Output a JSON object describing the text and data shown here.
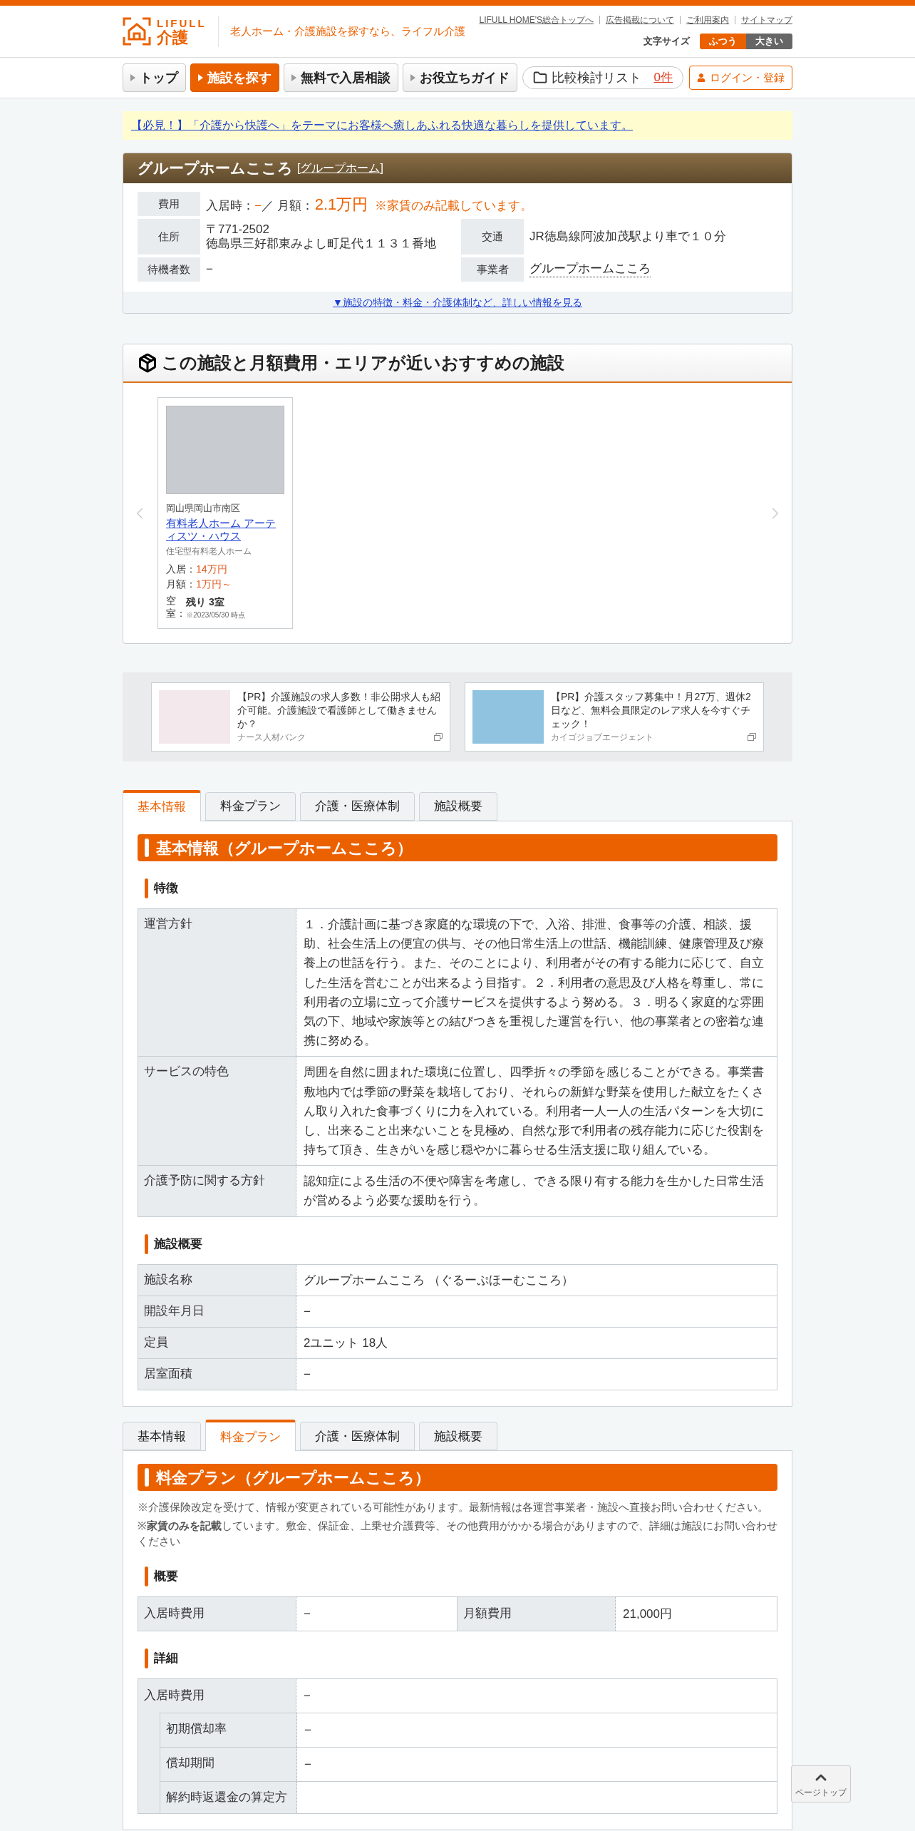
{
  "header": {
    "logo_text": "LIFULL",
    "logo_sub": "介護",
    "tagline": "老人ホーム・介護施設を探すなら、ライフル介護",
    "links": [
      "LIFULL HOME'S総合トップへ",
      "広告掲載について",
      "ご利用案内",
      "サイトマップ"
    ],
    "font_size": {
      "label": "文字サイズ",
      "options": [
        {
          "label": "ふつう",
          "selected": true
        },
        {
          "label": "大きい",
          "selected": false
        }
      ]
    }
  },
  "nav": {
    "items": [
      {
        "label": "トップ",
        "selected": false
      },
      {
        "label": "施設を探す",
        "selected": true
      },
      {
        "label": "無料で入居相談",
        "selected": false
      },
      {
        "label": "お役立ちガイド",
        "selected": false
      }
    ],
    "compare": {
      "label": "比較検討リスト",
      "count": "0件"
    },
    "login": "ログイン・登録"
  },
  "notice": "【必見！】「介護から快護へ」をテーマにお客様へ癒しあふれる快適な暮らしを提供しています。",
  "facility": {
    "name": "グループホームこころ",
    "type": "[グループホーム]",
    "cost": {
      "label": "費用",
      "parts": [
        {
          "kind": "plain",
          "text": "入居時："
        },
        {
          "kind": "accent",
          "text": "−"
        },
        {
          "kind": "plain",
          "text": "／ 月額："
        },
        {
          "kind": "price",
          "text": "2.1万円"
        },
        {
          "kind": "note",
          "text": "※家賃のみ記載しています。"
        }
      ]
    },
    "address": {
      "label": "住所",
      "lines": [
        "〒771-2502",
        "徳島県三好郡東みよし町足代１１３１番地"
      ]
    },
    "traffic": {
      "label": "交通",
      "value": "JR徳島線阿波加茂駅より車で１０分"
    },
    "waiting": {
      "label": "待機者数",
      "value": "−"
    },
    "operator": {
      "label": "事業者",
      "value": "グループホームこころ"
    },
    "more_link": "▼施設の特徴・料金・介護体制など、詳しい情報を見る"
  },
  "recommend": {
    "title": "この施設と月額費用・エリアが近いおすすめの施設",
    "items": [
      {
        "area": "岡山県岡山市南区",
        "name": "有料老人ホーム アーティスツ・ハウス",
        "type": "住宅型有料老人ホーム",
        "entry_label": "入居：",
        "entry": "14万円",
        "monthly_label": "月額：",
        "monthly": "1万円～",
        "vacancy_label": "空室：",
        "vacancy": "残り 3室",
        "vacancy_date": "※2023/05/30 時点"
      }
    ]
  },
  "ads": [
    {
      "text": "【PR】介護施設の求人多数！非公開求人も紹介可能。介護施設で看護師として働きませんか？",
      "source": "ナース人材バンク"
    },
    {
      "text": "【PR】介護スタッフ募集中！月27万、週休2日など、無料会員限定のレア求人を今すぐチェック！",
      "source": "カイゴジョブエージェント"
    }
  ],
  "sections": [
    {
      "tabs": [
        {
          "label": "基本情報",
          "selected": true
        },
        {
          "label": "料金プラン",
          "selected": false
        },
        {
          "label": "介護・医療体制",
          "selected": false
        },
        {
          "label": "施設概要",
          "selected": false
        }
      ],
      "title": "基本情報（グループホームこころ）",
      "groups": [
        {
          "heading": "特徴",
          "kind": "table",
          "rows": [
            {
              "label": "運営方針",
              "value": "１．介護計画に基づき家庭的な環境の下で、入浴、排泄、食事等の介護、相談、援助、社会生活上の便宜の供与、その他日常生活上の世話、機能訓練、健康管理及び療養上の世話を行う。また、そのことにより、利用者がその有する能力に応じて、自立した生活を営むことが出来るよう目指す。２．利用者の意思及び人格を尊重し、常に利用者の立場に立って介護サービスを提供するよう努める。３．明るく家庭的な雰囲気の下、地域や家族等との結びつきを重視した運営を行い、他の事業者との密着な連携に努める。"
            },
            {
              "label": "サービスの特色",
              "value": "周囲を自然に囲まれた環境に位置し、四季折々の季節を感じることができる。事業書敷地内では季節の野菜を栽培しており、それらの新鮮な野菜を使用した献立をたくさん取り入れた食事づくりに力を入れている。利用者一人一人の生活パターンを大切にし、出来ること出来ないことを見極め、自然な形で利用者の残存能力に応じた役割を持ちて頂き、生きがいを感じ穏やかに暮らせる生活支援に取り組んでいる。"
            },
            {
              "label": "介護予防に関する方針",
              "value": "認知症による生活の不便や障害を考慮し、できる限り有する能力を生かした日常生活が営めるよう必要な援助を行う。"
            }
          ]
        },
        {
          "heading": "施設概要",
          "kind": "table",
          "rows": [
            {
              "label": "施設名称",
              "value": "グループホームこころ （ぐるーぷほーむこころ）"
            },
            {
              "label": "開設年月日",
              "value": "−"
            },
            {
              "label": "定員",
              "value": "2ユニット 18人"
            },
            {
              "label": "居室面積",
              "value": "−"
            }
          ]
        }
      ]
    },
    {
      "tabs": [
        {
          "label": "基本情報",
          "selected": false
        },
        {
          "label": "料金プラン",
          "selected": true
        },
        {
          "label": "介護・医療体制",
          "selected": false
        },
        {
          "label": "施設概要",
          "selected": false
        }
      ],
      "title": "料金プラン（グループホームこころ）",
      "notes": [
        "※介護保険改定を受けて、情報が変更されている可能性があります。最新情報は各運営事業者・施設へ直接お問い合わせください。",
        "※**家賃のみを記載**しています。敷金、保証金、上乗せ介護費等、その他費用がかかる場合がありますので、詳細は施設にお問い合わせください"
      ],
      "groups": [
        {
          "heading": "概要",
          "kind": "pairs",
          "rows": [
            {
              "label": "入居時費用",
              "value": "−"
            },
            {
              "label": "月額費用",
              "value": "21,000円"
            }
          ]
        },
        {
          "heading": "詳細",
          "kind": "tree",
          "rows": [
            {
              "label": "入居時費用",
              "value": "−",
              "children": [
                {
                  "label": "初期償却率",
                  "value": "−"
                },
                {
                  "label": "償却期間",
                  "value": "−"
                },
                {
                  "label": "解約時返還金の算定方"
                }
              ]
            }
          ]
        }
      ]
    }
  ],
  "page_top": "ページトップ"
}
